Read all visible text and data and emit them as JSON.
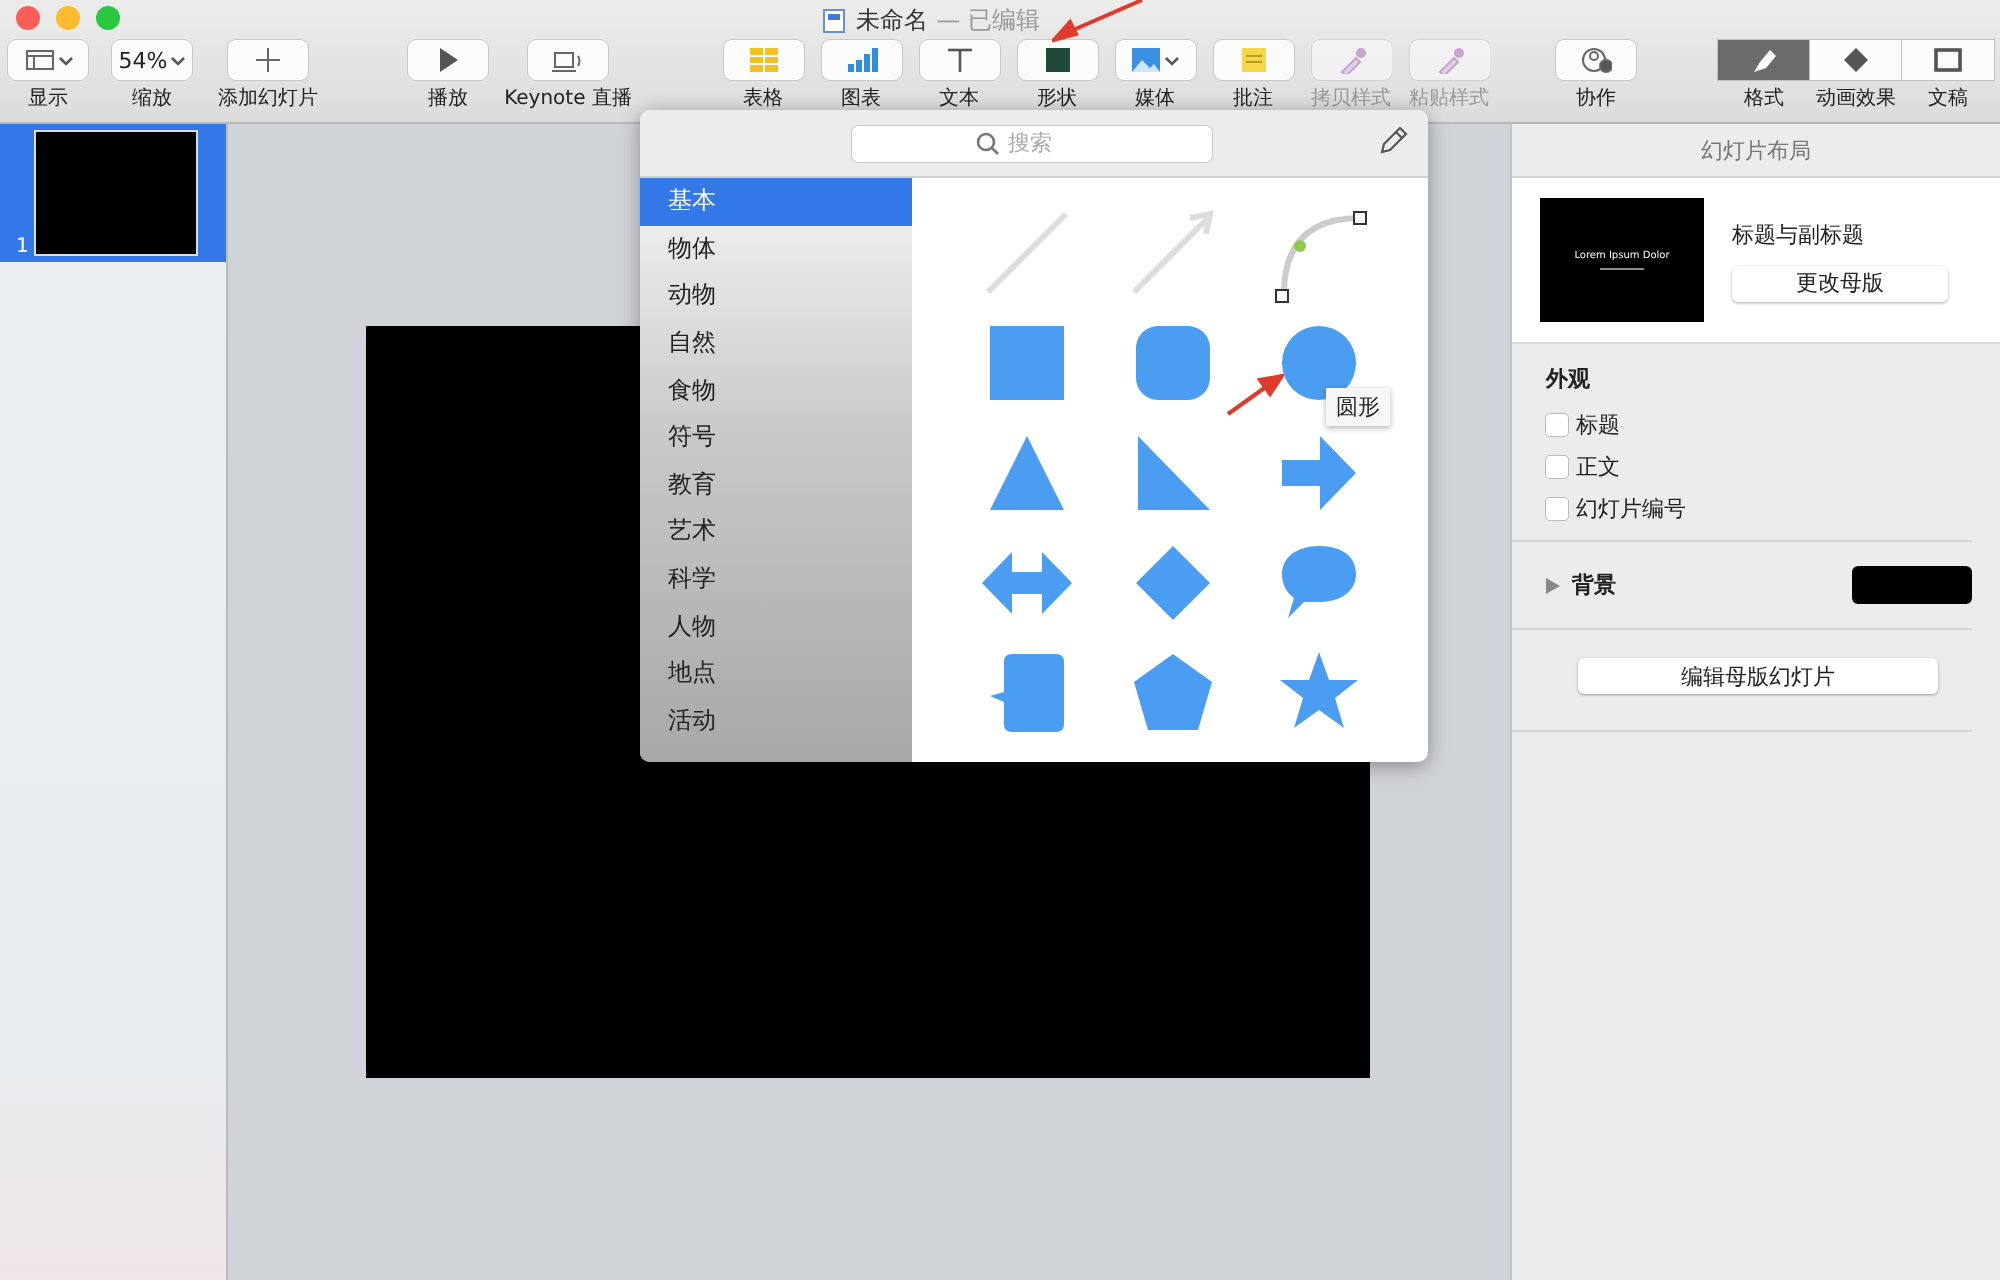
{
  "window": {
    "title": "未命名",
    "status": "— 已编辑"
  },
  "toolbar": {
    "groups": [
      {
        "items": [
          {
            "label": "显示",
            "menu": true,
            "disabled": false
          },
          {
            "label": "缩放",
            "value": "54%",
            "menu": true,
            "disabled": false
          },
          {
            "label": "添加幻灯片",
            "menu": false,
            "disabled": false
          }
        ]
      },
      {
        "items": [
          {
            "label": "播放",
            "menu": false,
            "disabled": false
          },
          {
            "label": "Keynote 直播",
            "menu": false,
            "disabled": false
          }
        ]
      },
      {
        "items": [
          {
            "label": "表格",
            "menu": false,
            "disabled": false
          },
          {
            "label": "图表",
            "menu": false,
            "disabled": false
          },
          {
            "label": "文本",
            "menu": false,
            "disabled": false
          },
          {
            "label": "形状",
            "menu": false,
            "disabled": false
          },
          {
            "label": "媒体",
            "menu": true,
            "disabled": false
          },
          {
            "label": "批注",
            "menu": false,
            "disabled": false
          },
          {
            "label": "拷贝样式",
            "menu": false,
            "disabled": true
          },
          {
            "label": "粘贴样式",
            "menu": false,
            "disabled": true
          }
        ]
      },
      {
        "items": [
          {
            "label": "协作",
            "menu": false,
            "disabled": false
          }
        ]
      }
    ],
    "inspector_tabs": [
      {
        "label": "格式",
        "selected": true
      },
      {
        "label": "动画效果",
        "selected": false
      },
      {
        "label": "文稿",
        "selected": false
      }
    ]
  },
  "slides": [
    {
      "number": "1",
      "selected": true
    }
  ],
  "shape_popover": {
    "search": {
      "placeholder": "搜索"
    },
    "categories": [
      {
        "label": "基本",
        "selected": true
      },
      {
        "label": "物体",
        "selected": false
      },
      {
        "label": "动物",
        "selected": false
      },
      {
        "label": "自然",
        "selected": false
      },
      {
        "label": "食物",
        "selected": false
      },
      {
        "label": "符号",
        "selected": false
      },
      {
        "label": "教育",
        "selected": false
      },
      {
        "label": "艺术",
        "selected": false
      },
      {
        "label": "科学",
        "selected": false
      },
      {
        "label": "人物",
        "selected": false
      },
      {
        "label": "地点",
        "selected": false
      },
      {
        "label": "活动",
        "selected": false
      }
    ],
    "tooltip": "圆形"
  },
  "inspector": {
    "header": "幻灯片布局",
    "master": {
      "thumb_title": "Lorem Ipsum Dolor",
      "name": "标题与副标题",
      "button": "更改母版"
    },
    "appearance": {
      "title": "外观",
      "options": [
        {
          "label": "标题",
          "checked": false
        },
        {
          "label": "正文",
          "checked": false
        },
        {
          "label": "幻灯片编号",
          "checked": false
        }
      ]
    },
    "background": {
      "label": "背景",
      "expanded": false,
      "color": "#000000"
    },
    "edit_button": "编辑母版幻灯片"
  }
}
